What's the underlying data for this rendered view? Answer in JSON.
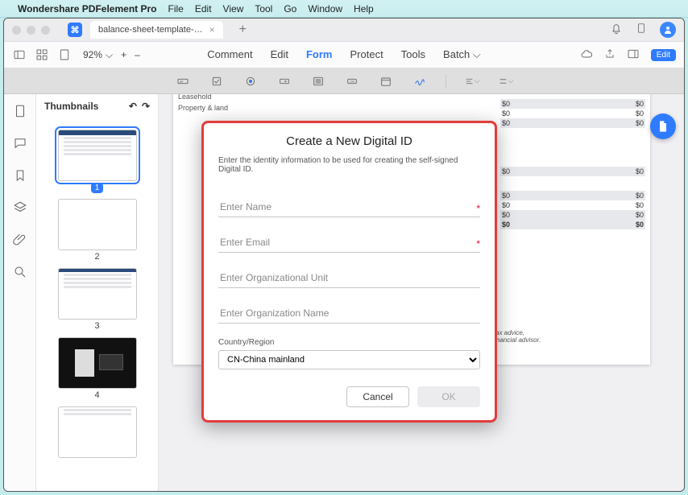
{
  "menubar": {
    "app_name": "Wondershare PDFelement Pro",
    "items": [
      "File",
      "Edit",
      "View",
      "Tool",
      "Go",
      "Window",
      "Help"
    ]
  },
  "titlebar": {
    "tab_title": "balance-sheet-template-…",
    "icons": {
      "bell": "bell-icon",
      "device": "device-icon",
      "avatar": "avatar"
    }
  },
  "toolbar1": {
    "zoom": "92%",
    "plus": "+",
    "minus": "–",
    "main_tabs": [
      "Comment",
      "Edit",
      "Form",
      "Protect",
      "Tools",
      "Batch"
    ],
    "active_tab_index": 2,
    "edit_pill": "Edit"
  },
  "toolbar2": {
    "icons": [
      "text-field-icon",
      "checkbox-icon",
      "radio-icon",
      "dropdown-icon",
      "listbox-icon",
      "button-ok-icon",
      "date-icon",
      "signature-icon",
      "sep",
      "align-icon",
      "distribute-icon"
    ]
  },
  "leftrail": {
    "icons": [
      "page-icon",
      "comment-icon",
      "bookmark-icon",
      "layers-icon",
      "attachment-icon",
      "search-icon"
    ]
  },
  "thumbnails": {
    "title": "Thumbnails",
    "pages": [
      1,
      2,
      3,
      4
    ]
  },
  "document": {
    "top_rows": [
      "Leasehold",
      "Property & land"
    ],
    "value_pairs": [
      [
        "$0",
        "$0"
      ],
      [
        "$0",
        "$0"
      ],
      [
        "$0",
        "$0"
      ],
      [
        "$0",
        "$0"
      ],
      [
        "$0",
        "$0"
      ],
      [
        "$0",
        "$0"
      ],
      [
        "$0",
        "$0"
      ],
      [
        "$0",
        "$0"
      ]
    ],
    "disclaimer1": "…ax advice,",
    "disclaimer2": "r financial advisor."
  },
  "fab": {
    "label": "file"
  },
  "modal": {
    "title": "Create a New Digital ID",
    "description": "Enter the identity information to be used for creating the self-signed Digital ID.",
    "fields": {
      "name_placeholder": "Enter Name",
      "email_placeholder": "Enter Email",
      "org_unit_placeholder": "Enter Organizational Unit",
      "org_name_placeholder": "Enter Organization Name"
    },
    "country_label": "Country/Region",
    "country_value": "CN-China mainland",
    "cancel": "Cancel",
    "ok": "OK",
    "required_marker": "*"
  }
}
